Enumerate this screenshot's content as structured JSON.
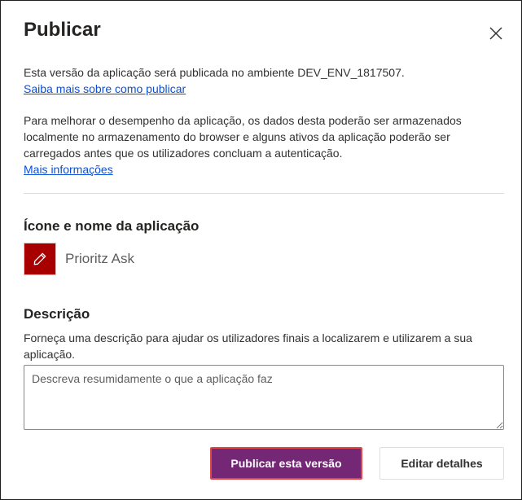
{
  "dialog": {
    "title": "Publicar",
    "close_icon": "close-icon"
  },
  "publish_info": {
    "text": "Esta versão da aplicação será publicada no ambiente DEV_ENV_1817507.",
    "link": "Saiba mais sobre como publicar"
  },
  "storage_info": {
    "text": "Para melhorar o desempenho da aplicação, os dados desta poderão ser armazenados localmente no armazenamento do browser e alguns ativos da aplicação poderão ser carregados antes que os utilizadores concluam a autenticação.",
    "link": "Mais informações"
  },
  "app_section": {
    "heading": "Ícone e nome da aplicação",
    "icon": "pencil-icon",
    "icon_bg": "#a80000",
    "name": "Prioritz Ask"
  },
  "description_section": {
    "heading": "Descrição",
    "help_text": "Forneça uma descrição para ajudar os utilizadores finais a localizarem e utilizarem a sua aplicação.",
    "placeholder": "Descreva resumidamente o que a aplicação faz",
    "value": ""
  },
  "actions": {
    "publish_label": "Publicar esta versão",
    "edit_label": "Editar detalhes",
    "primary_color": "#742774"
  }
}
